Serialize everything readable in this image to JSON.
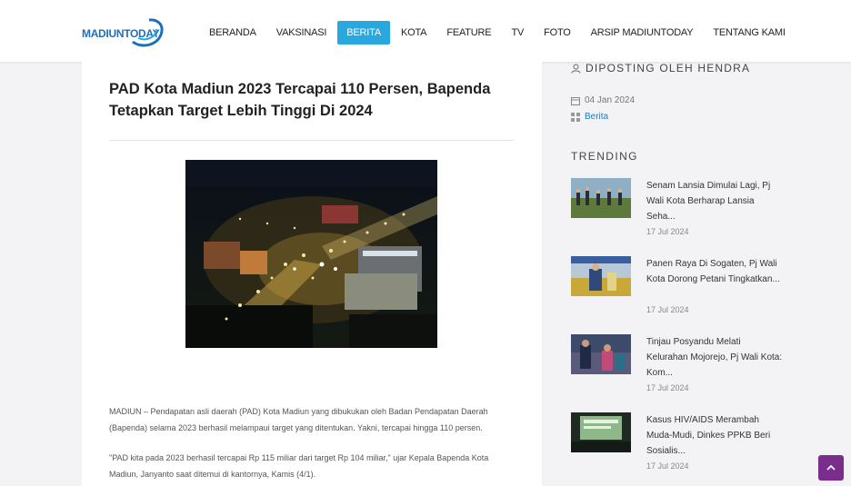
{
  "header": {
    "logo_text": "MADIUNTODAY",
    "nav": [
      "BERANDA",
      "VAKSINASI",
      "BERITA",
      "KOTA",
      "FEATURE",
      "TV",
      "FOTO",
      "ARSIP MADIUNTODAY",
      "TENTANG KAMI"
    ],
    "active_nav": "BERITA"
  },
  "article": {
    "title": "PAD Kota Madiun 2023 Tercapai 110 Persen, Bapenda Tetapkan Target Lebih Tinggi Di 2024",
    "paragraph_1": "MADIUN – Pendapatan asli daerah (PAD) Kota Madiun yang dibukukan oleh Badan Pendapatan Daerah (Bapenda) selama 2023 berhasil melampaui target yang ditentukan. Yakni, tercapai hingga 110 persen.",
    "paragraph_2": "\"PAD kita pada 2023 berhasil tercapai Rp 115 miliar dari target Rp 104 miliar,\" ujar Kepala Bapenda Kota Madiun, Janyanto saat ditemui di kantornya, Kamis (4/1)."
  },
  "sidebar": {
    "author": "DIPOSTING OLEH HENDRA",
    "date": "04 Jan 2024",
    "category": "Berita",
    "trending_heading": "TRENDING",
    "trending": [
      {
        "title": "Senam Lansia Dimulai Lagi, Pj Wali Kota Berharap Lansia Seha...",
        "date": "17 Jul 2024"
      },
      {
        "title": "Panen Raya Di Sogaten, Pj Wali Kota Dorong Petani Tingkatkan...",
        "date": "17 Jul 2024"
      },
      {
        "title": "Tinjau Posyandu Melati Kelurahan Mojorejo, Pj Wali Kota: Kom...",
        "date": "17 Jul 2024"
      },
      {
        "title": "Kasus HIV/AIDS Merambah Muda-Mudi, Dinkes PPKB Beri Sosialis...",
        "date": "17 Jul 2024"
      }
    ]
  },
  "colors": {
    "accent": "#29a8e0",
    "scroll_button": "#7b2d8e",
    "link": "#1f7bc1"
  }
}
